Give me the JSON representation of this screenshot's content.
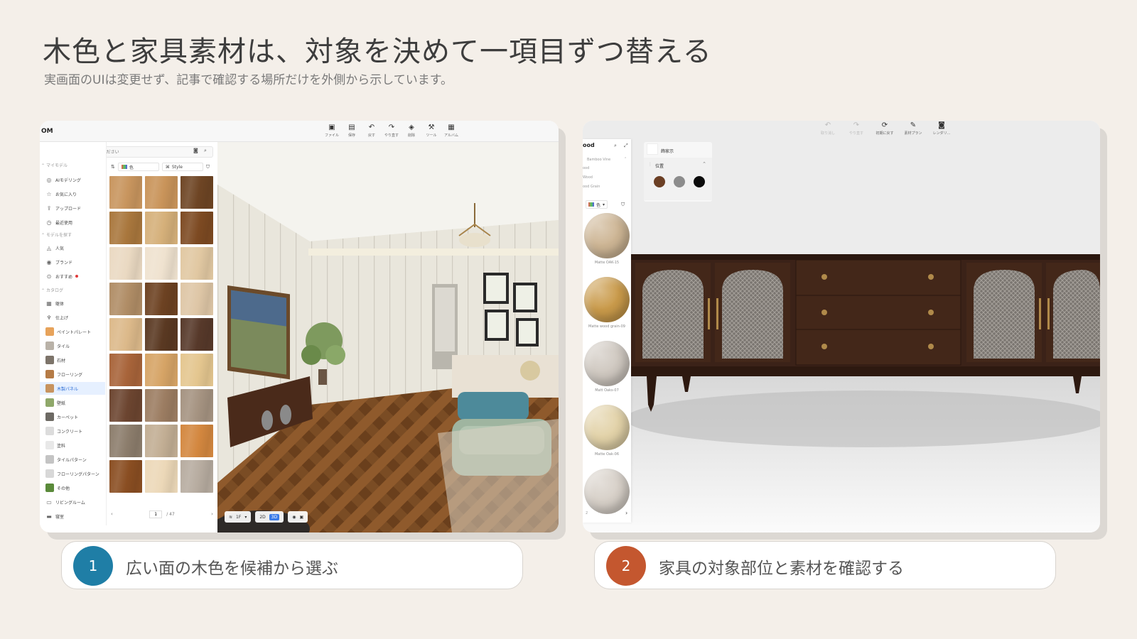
{
  "slide": {
    "title": "木色と家具素材は、対象を決めて一項目ずつ替える",
    "subtitle": "実画面のUIは変更せず、記事で確認する場所だけを外側から示しています。"
  },
  "left_app": {
    "logo": "OM",
    "toolbar": [
      {
        "icon": "file-icon",
        "glyph": "▣",
        "label": "ファイル"
      },
      {
        "icon": "save-icon",
        "glyph": "▤",
        "label": "保存"
      },
      {
        "icon": "undo-icon",
        "glyph": "↶",
        "label": "戻す"
      },
      {
        "icon": "redo-icon",
        "glyph": "↷",
        "label": "やり直す"
      },
      {
        "icon": "eraser-icon",
        "glyph": "◈",
        "label": "削除"
      },
      {
        "icon": "wrench-icon",
        "glyph": "⚒",
        "label": "ツール"
      },
      {
        "icon": "album-icon",
        "glyph": "▦",
        "label": "アルバム"
      }
    ],
    "search_placeholder": "キーワードを入力してください",
    "sections": {
      "my_models": "マイモデル",
      "find_models": "モデルを探す",
      "catalog": "カタログ"
    },
    "my_model_items": [
      {
        "icon": "ai-icon",
        "glyph": "◎",
        "label": "AIモデリング"
      },
      {
        "icon": "star-icon",
        "glyph": "☆",
        "label": "お気に入り"
      },
      {
        "icon": "upload-icon",
        "glyph": "⇪",
        "label": "アップロード"
      },
      {
        "icon": "clock-icon",
        "glyph": "◷",
        "label": "最近使用"
      }
    ],
    "find_items": [
      {
        "icon": "fire-icon",
        "glyph": "◬",
        "label": "人気"
      },
      {
        "icon": "brand-icon",
        "glyph": "◉",
        "label": "ブランド"
      },
      {
        "icon": "recommend-icon",
        "glyph": "⊙",
        "label": "おすすめ"
      }
    ],
    "catalog_items": [
      {
        "icon": "building-icon",
        "glyph": "▦",
        "label": "躯体"
      },
      {
        "icon": "finish-icon",
        "glyph": "♆",
        "label": "仕上げ"
      },
      {
        "swatch": "#e7a35b",
        "label": "ペイントパレート"
      },
      {
        "swatch": "#b9b2a8",
        "label": "タイル"
      },
      {
        "swatch": "#7d746a",
        "label": "石材"
      },
      {
        "swatch": "#b57b46",
        "label": "フローリング"
      },
      {
        "swatch": "#c7935f",
        "label": "木製パネル",
        "active": true
      },
      {
        "swatch": "#8fa86a",
        "label": "壁紙"
      },
      {
        "swatch": "#6d6a64",
        "label": "カーペット"
      },
      {
        "swatch": "#dcdcdc",
        "label": "コンクリート"
      },
      {
        "swatch": "#e8e8e8",
        "label": "塗料"
      },
      {
        "swatch": "#c4c4c4",
        "label": "タイルパターン"
      },
      {
        "swatch": "#d8d8d8",
        "label": "フローリングパターン"
      },
      {
        "swatch": "#5a8a3a",
        "label": "その他"
      },
      {
        "icon": "sofa-icon",
        "glyph": "▭",
        "label": "リビングルーム"
      },
      {
        "icon": "bed-icon",
        "glyph": "▬",
        "label": "寝室"
      }
    ],
    "filter": {
      "color": "色",
      "style": "Style"
    },
    "swatches": [
      "#c8955e",
      "#c9945a",
      "#6e4524",
      "#a9773d",
      "#d5b07a",
      "#7d4a22",
      "#ead9c2",
      "#efe2cf",
      "#e1c8a2",
      "#b08d66",
      "#6d4222",
      "#dec6a6",
      "#dcb98a",
      "#5a3922",
      "#57392a",
      "#a8643a",
      "#d6a466",
      "#e4c68f",
      "#6c4530",
      "#9c7d62",
      "#a59381",
      "#8c7d6c",
      "#c2ae94",
      "#d3873f",
      "#8a4e22",
      "#ecd8b8",
      "#b7aca0"
    ],
    "pager": {
      "page": "1",
      "total": "/ 47"
    },
    "view": {
      "floor": "1F",
      "mode_2d": "2D",
      "mode_3d": "3D"
    }
  },
  "right_app": {
    "toolbar": [
      {
        "icon": "undo-icon",
        "glyph": "↶",
        "label": "取り消し",
        "dim": true
      },
      {
        "icon": "redo-icon",
        "glyph": "↷",
        "label": "やり直す",
        "dim": true
      },
      {
        "icon": "reset-icon",
        "glyph": "⟳",
        "label": "初期に戻す"
      },
      {
        "icon": "brush-icon",
        "glyph": "✎",
        "label": "素材プラン"
      },
      {
        "icon": "camera-icon",
        "glyph": "◙",
        "label": "レンダリ..."
      }
    ],
    "panel_title": "ood",
    "categories": [
      "Bamboo Vine",
      "ood",
      "Wood",
      "ood Grain"
    ],
    "color_filter": "色",
    "materials": [
      {
        "name": "Matte OAK-15",
        "color": "#cdb594"
      },
      {
        "name": "Matte wood grain-09",
        "color": "#c99a4a"
      },
      {
        "name": "Matt Oaks-07",
        "color": "#cfc8c0"
      },
      {
        "name": "Matte Oak-06",
        "color": "#e2d2a8"
      },
      {
        "name": "",
        "color": "#d7d0c8"
      }
    ],
    "pager": {
      "page": "2"
    },
    "prop_title": "飾家示",
    "position_label": "位置",
    "colors": [
      "#6b3f24",
      "#8c8c8c",
      "#0b0b0b"
    ]
  },
  "captions": [
    {
      "num": "1",
      "text": "広い面の木色を候補から選ぶ",
      "color": "#1f7ea6"
    },
    {
      "num": "2",
      "text": "家具の対象部位と素材を確認する",
      "color": "#c4572f"
    }
  ]
}
